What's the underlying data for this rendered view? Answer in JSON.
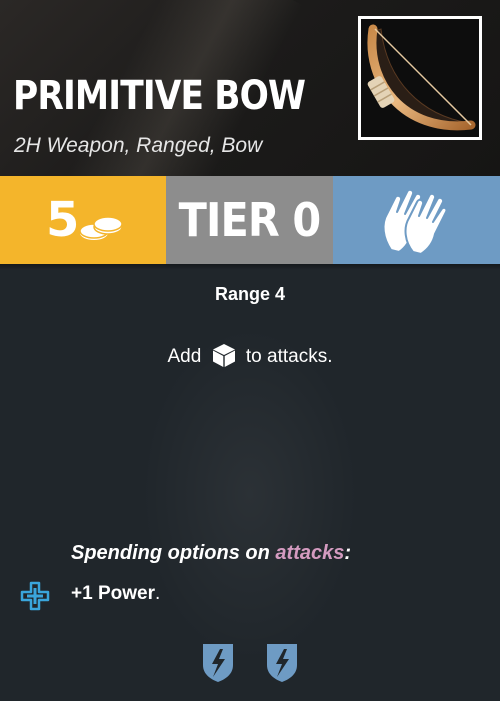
{
  "card": {
    "title": "PRIMITIVE BOW",
    "subtitle": "2H Weapon, Ranged, Bow",
    "portrait_icon": "bow-icon"
  },
  "stats": {
    "cost": "5",
    "cost_icon": "coins-icon",
    "tier": "TIER 0",
    "hands_icon": "two-hands-icon",
    "colors": {
      "cost": "#f4b52b",
      "tier": "#8d8d8d",
      "hands": "#6e9bc4"
    }
  },
  "body": {
    "range": "Range 4",
    "effect_prefix": "Add",
    "effect_icon": "die-cube-icon",
    "effect_suffix": "to attacks.",
    "spend_heading_prefix": "Spending options on ",
    "spend_heading_keyword": "attacks",
    "spend_heading_suffix": ":",
    "spend_option_icon": "cross-plus-icon",
    "spend_option_text": "+1 Power",
    "spend_option_end": ".",
    "surge_icons": [
      "surge-icon",
      "surge-icon"
    ],
    "keyword_color": "#d49bc0"
  }
}
